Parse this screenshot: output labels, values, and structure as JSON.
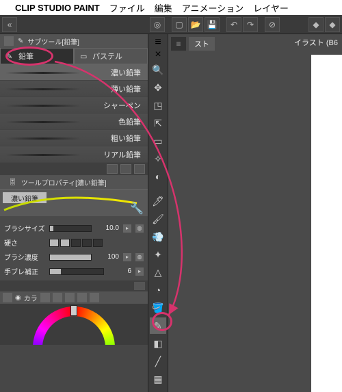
{
  "menubar": {
    "app": "CLIP STUDIO PAINT",
    "items": [
      "ファイル",
      "編集",
      "アニメーション",
      "レイヤー"
    ]
  },
  "subtool": {
    "title": "サブツール[鉛筆]",
    "tabs": [
      {
        "label": "鉛筆",
        "active": true
      },
      {
        "label": "パステル",
        "active": false
      }
    ],
    "brushes": [
      "濃い鉛筆",
      "薄い鉛筆",
      "シャーペン",
      "色鉛筆",
      "粗い鉛筆",
      "リアル鉛筆"
    ],
    "selected_index": 0
  },
  "tool_property": {
    "title": "ツールプロパティ[濃い鉛筆]",
    "preview_label": "濃い鉛筆",
    "rows": {
      "brush_size": {
        "label": "ブラシサイズ",
        "value": "10.0",
        "fill_pct": 8
      },
      "hardness": {
        "label": "硬さ",
        "blocks_on": 2,
        "blocks_total": 5
      },
      "density": {
        "label": "ブラシ濃度",
        "value": "100",
        "fill_pct": 100
      },
      "stabilize": {
        "label": "手ブレ補正",
        "value": "6",
        "fill_pct": 20
      }
    }
  },
  "color": {
    "label": "カラ"
  },
  "canvas": {
    "tab_label": "スト",
    "doc_title": "イラスト (B6"
  },
  "tool_icons": [
    "magnifier",
    "move",
    "ops",
    "select-rect",
    "select-auto",
    "eyedropper",
    "pencil",
    "brush",
    "airbrush",
    "decoration",
    "eraser",
    "blend",
    "fill",
    "gradient",
    "text",
    "ruler",
    "frame"
  ],
  "annotation": {
    "color": "#d6336c"
  }
}
